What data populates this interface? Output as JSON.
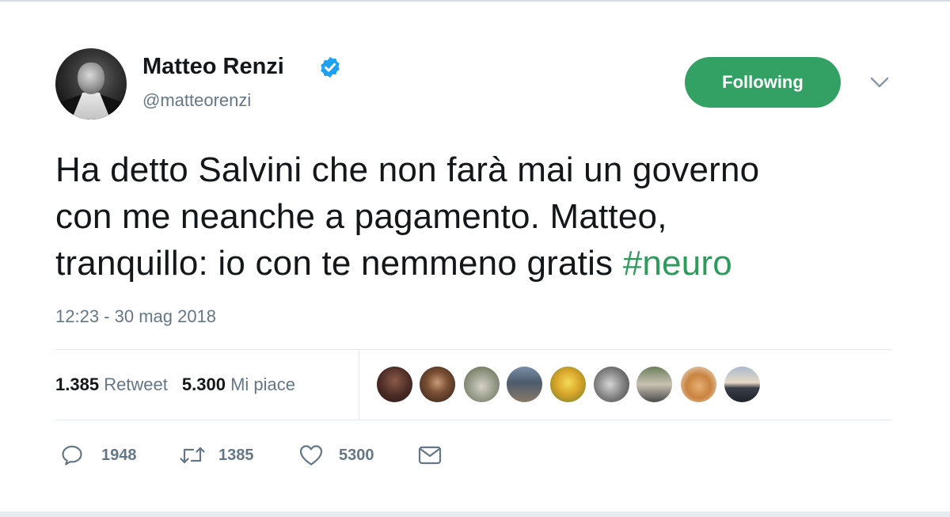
{
  "user": {
    "name": "Matteo Renzi",
    "handle": "@matteorenzi",
    "verified": true
  },
  "follow_button": {
    "label": "Following",
    "color": "#33a163"
  },
  "tweet": {
    "text_lines": [
      "Ha detto Salvini che non farà mai un governo",
      "con me neanche a pagamento. Matteo,",
      "tranquillo: io con te nemmeno gratis"
    ],
    "hashtag": "#neuro",
    "hashtag_color": "#2e9a5b",
    "timestamp": "12:23 - 30 mag 2018"
  },
  "stats": {
    "retweets_value": "1.385",
    "retweets_label": "Retweet",
    "likes_value": "5.300",
    "likes_label": "Mi piace"
  },
  "likers": [
    "liker-avatar-1",
    "liker-avatar-2",
    "liker-avatar-3",
    "liker-avatar-4",
    "liker-avatar-5",
    "liker-avatar-6",
    "liker-avatar-7",
    "liker-avatar-8",
    "liker-avatar-9"
  ],
  "actions": {
    "replies": "1948",
    "retweets": "1385",
    "likes": "5300"
  },
  "icons": {
    "verified": "verified-badge-icon",
    "caret": "chevron-down-icon",
    "reply": "reply-icon",
    "retweet": "retweet-icon",
    "like": "heart-icon",
    "dm": "envelope-icon"
  },
  "colors": {
    "text": "#14171a",
    "muted": "#657786",
    "verified": "#1da1f2"
  }
}
